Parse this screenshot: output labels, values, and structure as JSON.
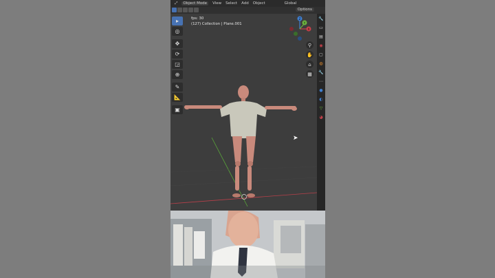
{
  "topbar": {
    "mode_label": "Object Mode",
    "menu": [
      "View",
      "Select",
      "Add",
      "Object"
    ],
    "transform_orientation": "Global"
  },
  "header2": {
    "options_label": "Options"
  },
  "overlay": {
    "fps_text": "fps: 30",
    "collection_text": "(127) Collection | Plane.001"
  },
  "gizmo": {
    "x_label": "X",
    "y_label": "Y",
    "z_label": "Z"
  },
  "icons": {
    "tools": [
      "cursor-select-icon",
      "cursor-3d-icon",
      "move-icon",
      "rotate-icon",
      "scale-icon",
      "transform-icon",
      "annotate-icon",
      "measure-icon",
      "add-cube-icon"
    ],
    "nav": [
      "zoom-icon",
      "hand-pan-icon",
      "camera-icon",
      "grid-icon"
    ],
    "right_strip": [
      "tool-icon",
      "render-icon",
      "output-icon",
      "view-layer-icon",
      "scene-icon",
      "world-icon",
      "collection-icon",
      "object-icon",
      "modifier-icon",
      "particles-icon",
      "physics-icon",
      "constraints-icon",
      "data-icon",
      "material-icon"
    ]
  },
  "colors": {
    "accent": "#4772b3",
    "viewport_bg": "#3d3d3d",
    "axis_x": "#c9404a",
    "axis_y": "#6cb33f",
    "axis_z": "#3f7fd1"
  }
}
